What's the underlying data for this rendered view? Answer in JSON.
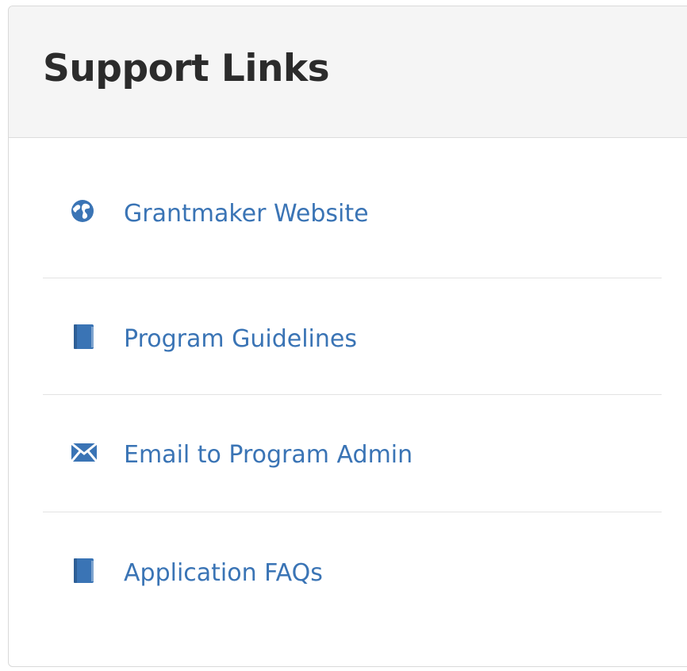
{
  "panel": {
    "title": "Support Links"
  },
  "links": [
    {
      "label": "Grantmaker Website",
      "icon": "globe-icon"
    },
    {
      "label": "Program Guidelines",
      "icon": "book-icon"
    },
    {
      "label": "Email to Program Admin",
      "icon": "envelope-icon"
    },
    {
      "label": "Application FAQs",
      "icon": "book-icon"
    }
  ],
  "colors": {
    "link": "#3a74b5",
    "icon": "#3a74b5",
    "header_bg": "#f5f5f5",
    "title": "#2b2b2b",
    "divider": "#e3e3e3"
  }
}
